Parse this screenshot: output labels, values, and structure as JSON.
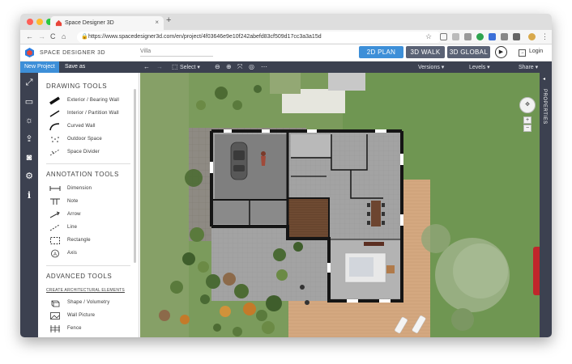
{
  "browser": {
    "tab_title": "Space Designer 3D",
    "tab_close": "×",
    "new_tab": "+",
    "url": "https://www.spacedesigner3d.com/en/project/4f03646e9e10f242abefd83cf509d17cc3a3a15d",
    "nav": {
      "back": "←",
      "forward": "→",
      "reload": "C",
      "home": "⌂"
    },
    "window_buttons": {
      "close": "#ff5f57",
      "minimize": "#febc2e",
      "maximize": "#28c840"
    }
  },
  "header": {
    "brand": "SPACE DESIGNER 3D",
    "project_name": "Villa",
    "modes": [
      {
        "label": "2D PLAN",
        "color": "#3d8fd8"
      },
      {
        "label": "3D WALK",
        "color": "#5a6275"
      },
      {
        "label": "3D GLOBAL",
        "color": "#5a6275"
      }
    ],
    "play": "▶",
    "login": "Login"
  },
  "toolbar": {
    "new_project": "New Project",
    "save_as": "Save as",
    "select": "Select ▾",
    "versions": "Versions ▾",
    "levels": "Levels ▾",
    "share": "Share ▾"
  },
  "rail": {
    "icons": [
      "expand-icon",
      "sofa-icon",
      "sun-icon",
      "export-icon",
      "camera-icon",
      "settings-icon",
      "info-icon"
    ],
    "glyphs": [
      "⤢",
      "▭",
      "☼",
      "⇪",
      "◙",
      "⚙",
      "i"
    ]
  },
  "panel": {
    "drawing_title": "DRAWING TOOLS",
    "drawing_tools": [
      "Exterior / Bearing Wall",
      "Interior / Partition Wall",
      "Curved Wall",
      "Outdoor Space",
      "Space Divider"
    ],
    "annotation_title": "ANNOTATION TOOLS",
    "annotation_tools": [
      "Dimension",
      "Note",
      "Arrow",
      "Line",
      "Rectangle",
      "Axis"
    ],
    "advanced_title": "ADVANCED TOOLS",
    "advanced_link": "CREATE ARCHITECTURAL ELEMENTS",
    "advanced_tools": [
      "Shape / Volumetry",
      "Wall Picture",
      "Fence"
    ]
  },
  "canvas": {
    "properties_label": "PROPERTIES",
    "zoom_in": "+",
    "zoom_out": "−",
    "colors": {
      "lawn": "#7b9b5c",
      "deck": "#d4a880",
      "floor": "#9a9a9a",
      "wall": "#1a1a1a",
      "paving": "#8a8680"
    }
  }
}
